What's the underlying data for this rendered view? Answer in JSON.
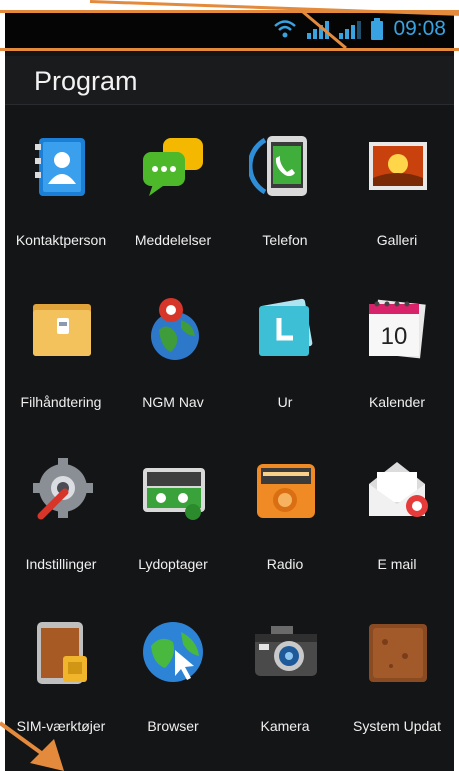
{
  "status": {
    "time": "09:08"
  },
  "header": {
    "title": "Program"
  },
  "apps": [
    {
      "label": "Kontaktperson",
      "icon": "contacts-icon"
    },
    {
      "label": "Meddelelser",
      "icon": "messages-icon"
    },
    {
      "label": "Telefon",
      "icon": "phone-icon"
    },
    {
      "label": "Galleri",
      "icon": "gallery-icon"
    },
    {
      "label": "Filhåndtering",
      "icon": "folder-icon"
    },
    {
      "label": "NGM Nav",
      "icon": "globe-nav-icon"
    },
    {
      "label": "Ur",
      "icon": "clock-icon"
    },
    {
      "label": "Kalender",
      "icon": "calendar-icon",
      "badge": "10"
    },
    {
      "label": "Indstillinger",
      "icon": "settings-icon"
    },
    {
      "label": "Lydoptager",
      "icon": "recorder-icon"
    },
    {
      "label": "Radio",
      "icon": "radio-icon"
    },
    {
      "label": "E mail",
      "icon": "email-icon"
    },
    {
      "label": "SIM-værktøjer",
      "icon": "sim-tools-icon"
    },
    {
      "label": "Browser",
      "icon": "browser-icon"
    },
    {
      "label": "Kamera",
      "icon": "camera-icon"
    },
    {
      "label": "System Updat",
      "icon": "system-update-icon"
    }
  ],
  "colors": {
    "accent_blue": "#39a2e0",
    "annotation_orange": "#e48a3c",
    "background": "#141517"
  }
}
